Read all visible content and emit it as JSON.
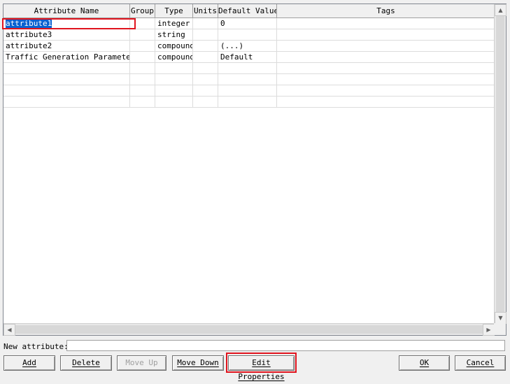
{
  "grid": {
    "columns": [
      "Attribute Name",
      "Group",
      "Type",
      "Units",
      "Default Value",
      "Tags"
    ],
    "rows": [
      {
        "name": "attribute1",
        "group": "",
        "type": "integer",
        "units": "",
        "default": "0",
        "tags": ""
      },
      {
        "name": "attribute3",
        "group": "",
        "type": "string",
        "units": "",
        "default": "",
        "tags": ""
      },
      {
        "name": "attribute2",
        "group": "",
        "type": "compound",
        "units": "",
        "default": "(...)",
        "tags": ""
      },
      {
        "name": "Traffic Generation Parameters",
        "group": "",
        "type": "compound",
        "units": "",
        "default": "Default",
        "tags": ""
      },
      {
        "name": "",
        "group": "",
        "type": "",
        "units": "",
        "default": "",
        "tags": ""
      },
      {
        "name": "",
        "group": "",
        "type": "",
        "units": "",
        "default": "",
        "tags": ""
      },
      {
        "name": "",
        "group": "",
        "type": "",
        "units": "",
        "default": "",
        "tags": ""
      },
      {
        "name": "",
        "group": "",
        "type": "",
        "units": "",
        "default": "",
        "tags": ""
      }
    ],
    "selected_row": 0
  },
  "new_attribute": {
    "label": "New attribute:",
    "value": ""
  },
  "buttons": {
    "add": "Add",
    "delete": "Delete",
    "move_up": "Move Up",
    "move_down": "Move Down",
    "edit_properties": "Edit Properties",
    "ok": "OK",
    "cancel": "Cancel"
  },
  "colors": {
    "selection": "#0a62d0",
    "highlight": "#e0141e"
  },
  "icons": {
    "scroll_up": "scroll-up-arrow-icon",
    "scroll_down": "scroll-down-arrow-icon",
    "scroll_left": "scroll-left-arrow-icon",
    "scroll_right": "scroll-right-arrow-icon"
  }
}
